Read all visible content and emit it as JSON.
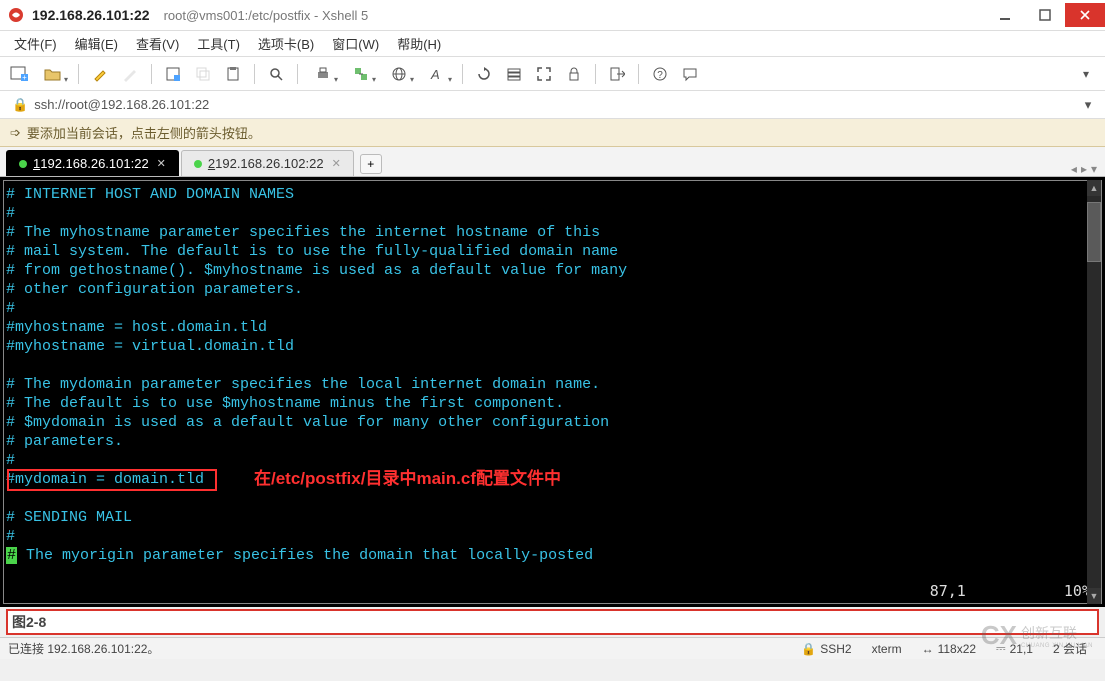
{
  "title": {
    "ip": "192.168.26.101:22",
    "path": "root@vms001:/etc/postfix - Xshell 5"
  },
  "menus": {
    "file": "文件(F)",
    "edit": "编辑(E)",
    "view": "查看(V)",
    "tools": "工具(T)",
    "tabs": "选项卡(B)",
    "window": "窗口(W)",
    "help": "帮助(H)"
  },
  "address": {
    "url": "ssh://root@192.168.26.101:22"
  },
  "tip": {
    "text": "要添加当前会话，点击左侧的箭头按钮。"
  },
  "tabs": {
    "t1_prefix": "1",
    "t1_label": " 192.168.26.101:22",
    "t2_prefix": "2",
    "t2_label": " 192.168.26.102:22",
    "add": "+"
  },
  "terminal": {
    "line1": "# INTERNET HOST AND DOMAIN NAMES",
    "line2": "#",
    "line3": "# The myhostname parameter specifies the internet hostname of this",
    "line4": "# mail system. The default is to use the fully-qualified domain name",
    "line5": "# from gethostname(). $myhostname is used as a default value for many",
    "line6": "# other configuration parameters.",
    "line7": "#",
    "line8": "#myhostname = host.domain.tld",
    "line9": "#myhostname = virtual.domain.tld",
    "line10": "",
    "line11": "# The mydomain parameter specifies the local internet domain name.",
    "line12": "# The default is to use $myhostname minus the first component.",
    "line13": "# $mydomain is used as a default value for many other configuration",
    "line14": "# parameters.",
    "line15": "#",
    "line16": "#mydomain = domain.tld",
    "line17": "",
    "line18": "# SENDING MAIL",
    "line19": "#",
    "line20a": "#",
    "line20b": " The myorigin parameter specifies the domain that locally-posted",
    "annotation": "在/etc/postfix/目录中main.cf配置文件中",
    "cursor_pos": "87,1",
    "scroll_pct": "10%"
  },
  "input": {
    "value": "图2-8"
  },
  "status": {
    "left": "已连接 192.168.26.101:22。",
    "ssh": "SSH2",
    "term": "xterm",
    "size": "118x22",
    "pos": "21,1",
    "sessions": "2 会话"
  },
  "watermark": {
    "logo": "CX",
    "txt1": "创新互联",
    "txt2": "CHUANG XIN HU LIAN"
  }
}
